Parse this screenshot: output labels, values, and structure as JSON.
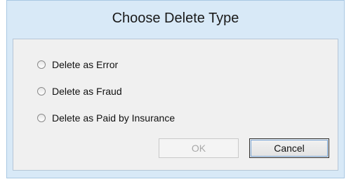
{
  "dialog": {
    "title": "Choose Delete Type",
    "options": [
      {
        "label": "Delete as Error",
        "selected": false
      },
      {
        "label": "Delete as Fraud",
        "selected": false
      },
      {
        "label": "Delete as Paid by Insurance",
        "selected": false
      }
    ],
    "buttons": {
      "ok_label": "OK",
      "ok_enabled": false,
      "cancel_label": "Cancel"
    }
  }
}
